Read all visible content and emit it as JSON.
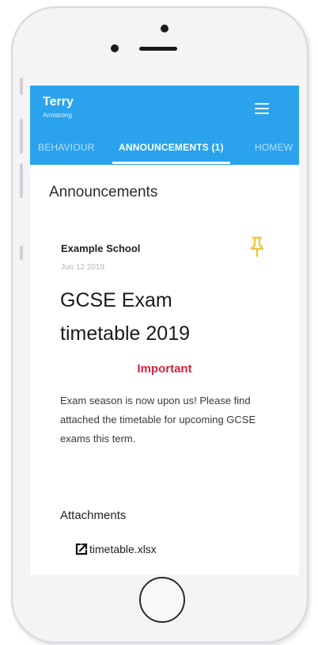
{
  "header": {
    "user_first_name": "Terry",
    "user_last_name": "Armstrong",
    "menu_icon": "hamburger-menu-icon"
  },
  "tabs": [
    {
      "label": "BEHAVIOUR",
      "active": false
    },
    {
      "label": "ANNOUNCEMENTS (1)",
      "active": true
    },
    {
      "label": "HOMEW",
      "active": false
    }
  ],
  "page": {
    "title": "Announcements"
  },
  "announcement": {
    "school": "Example School",
    "date": "Jun 12 2019",
    "title": "GCSE Exam timetable 2019",
    "priority": "Important",
    "body": "Exam season is now upon us! Please find attached the timetable for upcoming GCSE exams this term.",
    "pinned": true,
    "pin_icon": "pin-icon"
  },
  "attachments": {
    "heading": "Attachments",
    "items": [
      {
        "name": "timetable.xlsx",
        "icon": "external-link-icon"
      }
    ]
  },
  "colors": {
    "appbar": "#2aa3ec",
    "priority": "#d5243c",
    "pin": "#f4c542"
  }
}
